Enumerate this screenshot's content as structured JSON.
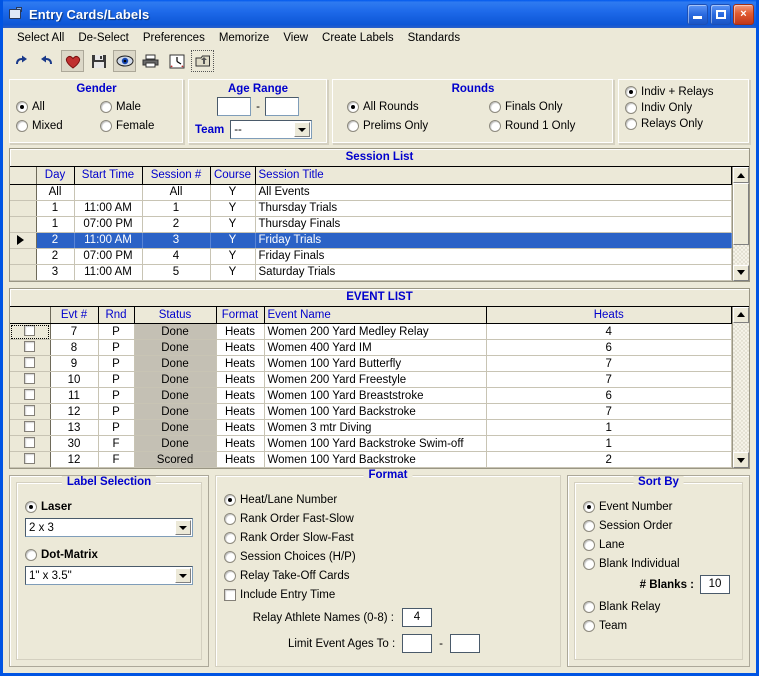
{
  "window": {
    "title": "Entry Cards/Labels",
    "icon": "window-document-icon",
    "minimize_label": "Minimize",
    "maximize_label": "Restore",
    "close_label": "×"
  },
  "menu": {
    "items": [
      {
        "label": "Select All"
      },
      {
        "label": "De-Select"
      },
      {
        "label": "Preferences"
      },
      {
        "label": "Memorize"
      },
      {
        "label": "View"
      },
      {
        "label": "Create Labels"
      },
      {
        "label": "Standards"
      }
    ]
  },
  "toolbar": {
    "buttons": [
      {
        "name": "redo-icon",
        "glyph": "↷"
      },
      {
        "name": "undo-icon",
        "glyph": "↶"
      },
      {
        "name": "heart-icon",
        "glyph": "♥"
      },
      {
        "name": "save-icon",
        "glyph": "💾"
      },
      {
        "name": "preview-eye-icon",
        "glyph": "◉"
      },
      {
        "name": "print-icon",
        "glyph": "🖶"
      },
      {
        "name": "clock-icon",
        "glyph": "🕐"
      },
      {
        "name": "exit-icon",
        "glyph": "⬆"
      }
    ]
  },
  "filters": {
    "gender": {
      "legend": "Gender",
      "options": [
        {
          "label": "All",
          "selected": true
        },
        {
          "label": "Male",
          "selected": false
        },
        {
          "label": "Mixed",
          "selected": false
        },
        {
          "label": "Female",
          "selected": false
        }
      ]
    },
    "age_range": {
      "legend": "Age Range",
      "low": "",
      "high": "",
      "separator": "-",
      "team_label": "Team",
      "team_value": "--"
    },
    "rounds": {
      "legend": "Rounds",
      "options": [
        {
          "label": "All Rounds",
          "selected": true
        },
        {
          "label": "Finals Only",
          "selected": false
        },
        {
          "label": "Prelims Only",
          "selected": false
        },
        {
          "label": "Round 1 Only",
          "selected": false
        }
      ]
    },
    "entry_type": {
      "options": [
        {
          "label": "Indiv + Relays",
          "selected": true
        },
        {
          "label": "Indiv Only",
          "selected": false
        },
        {
          "label": "Relays Only",
          "selected": false
        }
      ]
    }
  },
  "session_list": {
    "title": "Session List",
    "columns": [
      "Day",
      "Start Time",
      "Session #",
      "Course",
      "Session Title"
    ],
    "rows": [
      {
        "day": "All",
        "start_time": "",
        "session": "All",
        "course": "Y",
        "title": "All Events",
        "selected": false
      },
      {
        "day": "1",
        "start_time": "11:00 AM",
        "session": "1",
        "course": "Y",
        "title": "Thursday Trials",
        "selected": false
      },
      {
        "day": "1",
        "start_time": "07:00 PM",
        "session": "2",
        "course": "Y",
        "title": "Thursday Finals",
        "selected": false
      },
      {
        "day": "2",
        "start_time": "11:00 AM",
        "session": "3",
        "course": "Y",
        "title": "Friday Trials",
        "selected": true
      },
      {
        "day": "2",
        "start_time": "07:00 PM",
        "session": "4",
        "course": "Y",
        "title": "Friday Finals",
        "selected": false
      },
      {
        "day": "3",
        "start_time": "11:00 AM",
        "session": "5",
        "course": "Y",
        "title": "Saturday Trials",
        "selected": false
      }
    ]
  },
  "event_list": {
    "title": "EVENT LIST",
    "columns": [
      "Evt #",
      "Rnd",
      "Status",
      "Format",
      "Event Name",
      "Heats"
    ],
    "rows": [
      {
        "evt": "7",
        "rnd": "P",
        "status": "Done",
        "format": "Heats",
        "name": "Women 200 Yard Medley Relay",
        "heats": "4",
        "checked": false,
        "focus": true
      },
      {
        "evt": "8",
        "rnd": "P",
        "status": "Done",
        "format": "Heats",
        "name": "Women 400 Yard IM",
        "heats": "6",
        "checked": false,
        "focus": false
      },
      {
        "evt": "9",
        "rnd": "P",
        "status": "Done",
        "format": "Heats",
        "name": "Women 100 Yard Butterfly",
        "heats": "7",
        "checked": false,
        "focus": false
      },
      {
        "evt": "10",
        "rnd": "P",
        "status": "Done",
        "format": "Heats",
        "name": "Women 200 Yard Freestyle",
        "heats": "7",
        "checked": false,
        "focus": false
      },
      {
        "evt": "11",
        "rnd": "P",
        "status": "Done",
        "format": "Heats",
        "name": "Women 100 Yard Breaststroke",
        "heats": "6",
        "checked": false,
        "focus": false
      },
      {
        "evt": "12",
        "rnd": "P",
        "status": "Done",
        "format": "Heats",
        "name": "Women 100 Yard Backstroke",
        "heats": "7",
        "checked": false,
        "focus": false
      },
      {
        "evt": "13",
        "rnd": "P",
        "status": "Done",
        "format": "Heats",
        "name": "Women 3 mtr Diving",
        "heats": "1",
        "checked": false,
        "focus": false
      },
      {
        "evt": "30",
        "rnd": "F",
        "status": "Done",
        "format": "Heats",
        "name": "Women 100 Yard Backstroke Swim-off",
        "heats": "1",
        "checked": false,
        "focus": false
      },
      {
        "evt": "12",
        "rnd": "F",
        "status": "Scored",
        "format": "Heats",
        "name": "Women 100 Yard Backstroke",
        "heats": "2",
        "checked": false,
        "focus": false
      }
    ]
  },
  "label_selection": {
    "legend": "Label Selection",
    "laser": {
      "label": "Laser",
      "selected": true,
      "size": "2 x 3"
    },
    "dot_matrix": {
      "label": "Dot-Matrix",
      "selected": false,
      "size": "1\" x 3.5\""
    }
  },
  "format": {
    "legend": "Format",
    "options": [
      {
        "label": "Heat/Lane Number",
        "selected": true
      },
      {
        "label": "Rank Order Fast-Slow",
        "selected": false
      },
      {
        "label": "Rank Order Slow-Fast",
        "selected": false
      },
      {
        "label": "Session Choices (H/P)",
        "selected": false
      },
      {
        "label": "Relay Take-Off Cards",
        "selected": false
      }
    ],
    "include_entry_time": {
      "label": "Include Entry Time",
      "checked": false
    },
    "relay_athlete_names": {
      "label": "Relay Athlete Names (0-8) :",
      "value": "4"
    },
    "limit_event_ages": {
      "label": "Limit Event Ages To :",
      "low": "",
      "high": "",
      "separator": "-"
    }
  },
  "sort_by": {
    "legend": "Sort By",
    "options": [
      {
        "label": "Event Number",
        "selected": true
      },
      {
        "label": "Session Order",
        "selected": false
      },
      {
        "label": "Lane",
        "selected": false
      },
      {
        "label": "Blank Individual",
        "selected": false
      },
      {
        "label": "Blank Relay",
        "selected": false
      },
      {
        "label": "Team",
        "selected": false
      }
    ],
    "blanks": {
      "label": "# Blanks :",
      "value": "10"
    }
  },
  "colors": {
    "title_blue": "#0054e3",
    "face": "#ece9d8",
    "legend_blue": "#0000cc",
    "selection_blue": "#2b62c6",
    "status_gray": "#c4c0b4"
  }
}
